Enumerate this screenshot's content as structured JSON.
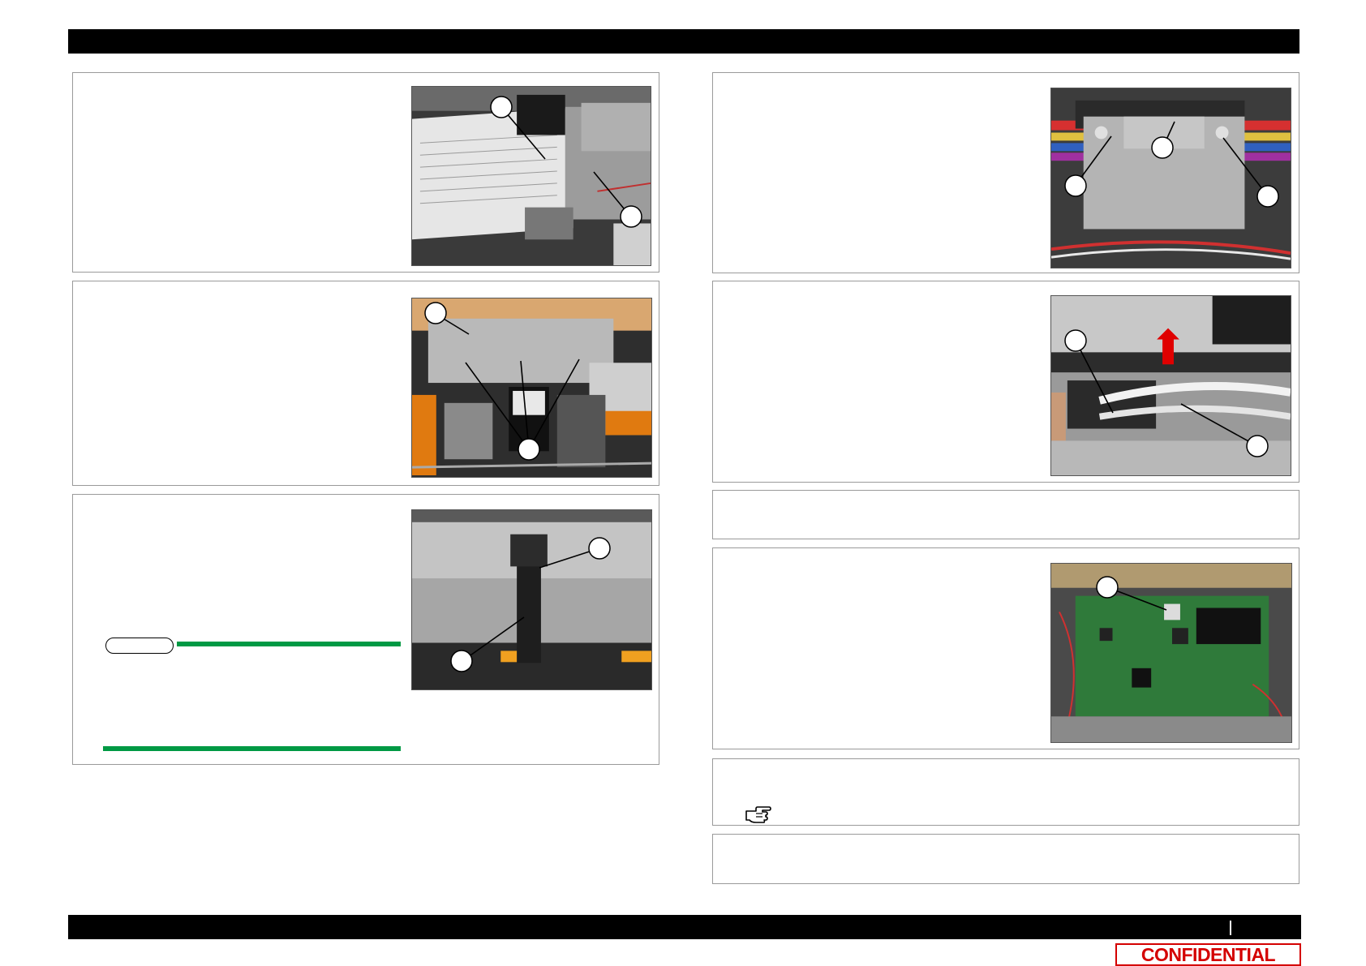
{
  "footer": {
    "confidential_label": "CONFIDENTIAL"
  },
  "icons": {
    "reference": "pointing-hand-icon"
  },
  "colors": {
    "note_rule": "#009944",
    "confidential": "#d40000",
    "arrow": "#e00000",
    "header_bar": "#000000"
  }
}
